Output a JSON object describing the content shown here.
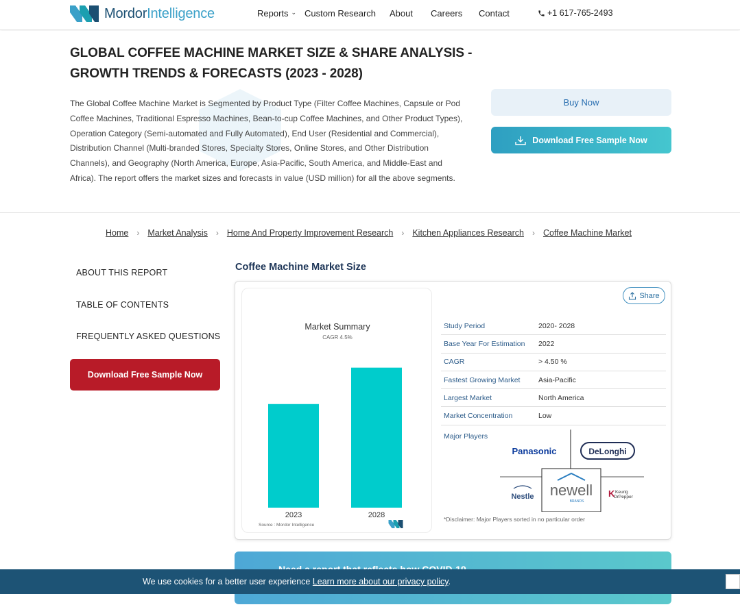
{
  "header": {
    "logo_bold": "Mordor",
    "logo_light": "Intelligence",
    "nav": [
      {
        "label": "Reports"
      },
      {
        "label": "Custom Research"
      },
      {
        "label": "About"
      },
      {
        "label": "Careers"
      },
      {
        "label": "Contact"
      }
    ],
    "phone": "+1 617-765-2493"
  },
  "hero": {
    "title_line1": "GLOBAL COFFEE MACHINE MARKET SIZE & SHARE ANALYSIS -",
    "title_line2": "GROWTH TRENDS & FORECASTS (2023 - 2028)",
    "description": "The Global Coffee Machine Market is Segmented by Product Type (Filter Coffee Machines, Capsule or Pod Coffee Machines, Traditional Espresso Machines, Bean-to-cup Coffee Machines, and Other Product Types), Operation Category (Semi-automated and Fully Automated), End User (Residential and Commercial), Distribution Channel (Multi-branded Stores, Specialty Stores, Online Stores, and Other Distribution Channels), and Geography (North America, Europe, Asia-Pacific, South America, and Middle-East and Africa). The report offers the market sizes and forecasts in value (USD million) for all the above segments.",
    "buy_label": "Buy Now",
    "download_label": "Download Free Sample Now"
  },
  "breadcrumb": [
    "Home",
    "Market Analysis",
    "Home And Property Improvement Research",
    "Kitchen Appliances Research",
    "Coffee Machine Market"
  ],
  "sidebar": {
    "items": [
      "ABOUT THIS REPORT",
      "TABLE OF CONTENTS",
      "FREQUENTLY ASKED QUESTIONS"
    ],
    "download_label": "Download Free Sample Now"
  },
  "section": {
    "title": "Coffee Machine Market Size",
    "share_label": "Share",
    "chart_title": "Market Summary",
    "chart_subtitle": "CAGR 4.5%",
    "chart_source": "Source : Mordor Intelligence",
    "study": [
      {
        "key": "Study Period",
        "value": "2020- 2028"
      },
      {
        "key": "Base Year For Estimation",
        "value": "2022"
      },
      {
        "key": "CAGR",
        "value": "> 4.50 %"
      },
      {
        "key": "Fastest Growing Market",
        "value": "Asia-Pacific"
      },
      {
        "key": "Largest Market",
        "value": "North America"
      },
      {
        "key": "Market Concentration",
        "value": "Low"
      }
    ],
    "players_label": "Major Players",
    "players": {
      "p1": "Panasonic",
      "p2": "DeLonghi",
      "p3": "Nestle",
      "p4": "newell",
      "p4_sub": "BRANDS",
      "p5_a": "Keurig",
      "p5_b": "DrPepper"
    },
    "disclaimer": "*Disclaimer: Major Players sorted in no particular order"
  },
  "banner": {
    "text": "Need a report that reflects how COVID-19"
  },
  "cookie": {
    "text": "We use cookies for a better user experience ",
    "link": "Learn more about our privacy policy",
    "suffix": "."
  },
  "colors": {
    "accent": "#00cccc",
    "brand_dark": "#1b4f72",
    "cta_red": "#b81b28",
    "cookie_bg": "#1d5375"
  },
  "chart_data": {
    "type": "bar",
    "title": "Market Summary",
    "subtitle": "CAGR 4.5%",
    "categories": [
      "2023",
      "2028"
    ],
    "values": [
      0.74,
      1.0
    ],
    "ylim": [
      0,
      1.15
    ],
    "grid": false,
    "legend": "none"
  }
}
